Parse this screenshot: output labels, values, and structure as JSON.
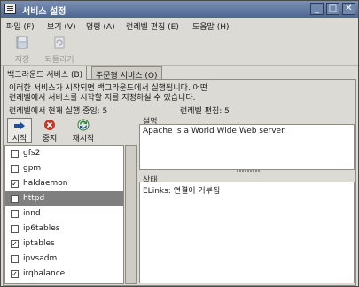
{
  "window": {
    "title": "서비스 설정"
  },
  "menu": [
    "파일 (F)",
    "보기 (V)",
    "명령 (A)",
    "런레벨 편집 (E)",
    "도움말 (H)"
  ],
  "toolbar": {
    "save_label": "저장",
    "revert_label": "되돌리기"
  },
  "tabs": [
    "백그라운드 서비스 (B)",
    "주문형 서비스 (O)"
  ],
  "description": {
    "line1": "이러한 서비스가 시작되면 백그라운드에서 실행됩니다. 어떤",
    "line2": "런레벨에서 서비스를 시작할 지를 지정하실 수 있습니다."
  },
  "status": {
    "current": "런레벨에서 현재 실행 중임: 5",
    "editing": "런레벨 편집: 5"
  },
  "actions": {
    "start": "시작",
    "stop": "중지",
    "restart": "재시작"
  },
  "services": [
    {
      "name": "gfs2",
      "checked": false,
      "selected": false
    },
    {
      "name": "gpm",
      "checked": false,
      "selected": false
    },
    {
      "name": "haldaemon",
      "checked": true,
      "selected": false
    },
    {
      "name": "httpd",
      "checked": false,
      "selected": true
    },
    {
      "name": "innd",
      "checked": false,
      "selected": false
    },
    {
      "name": "ip6tables",
      "checked": false,
      "selected": false
    },
    {
      "name": "iptables",
      "checked": true,
      "selected": false
    },
    {
      "name": "ipvsadm",
      "checked": false,
      "selected": false
    },
    {
      "name": "irqbalance",
      "checked": true,
      "selected": false
    }
  ],
  "details": {
    "desc_label": "설명",
    "desc_text": "Apache is a World Wide Web server.",
    "state_label": "상태",
    "state_text": "ELinks: 연결이 거부됨"
  },
  "colors": {
    "titlebar": "#4d6791",
    "selection": "#7f7f7f",
    "save_icon": "#5577aa",
    "stop_icon": "#c0392b",
    "restart_icon": "#2e7d32",
    "start_icon": "#1f4e9c"
  },
  "icons": [
    "service-config-icon",
    "save-icon",
    "revert-icon",
    "start-icon",
    "stop-icon",
    "restart-icon"
  ]
}
